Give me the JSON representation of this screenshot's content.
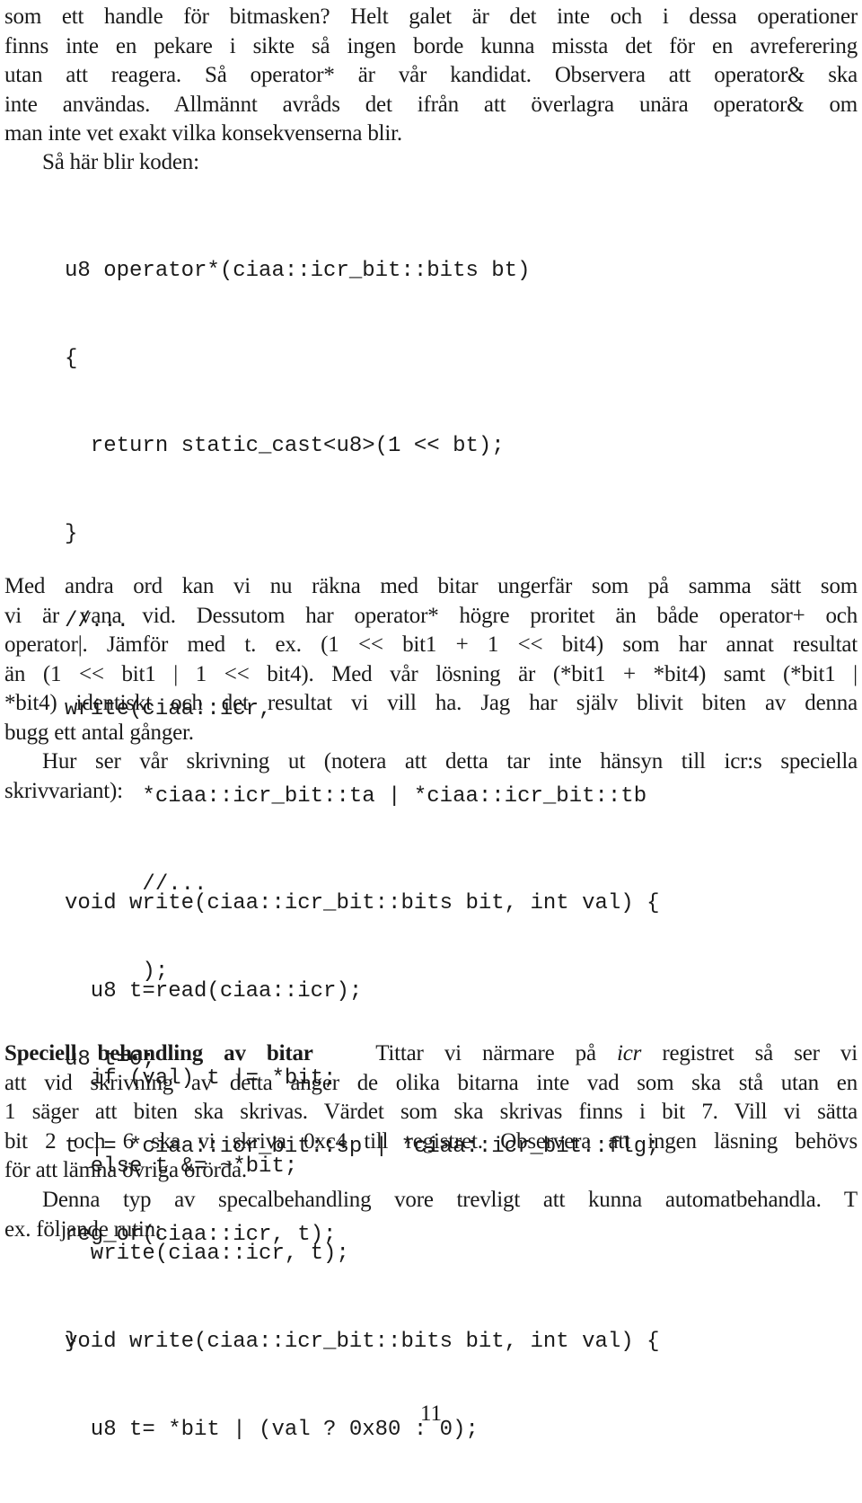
{
  "paragraph_1": {
    "lines": [
      "som ett handle för bitmasken?  Helt galet är det inte och i dessa operationer",
      "finns inte en pekare i sikte så ingen borde kunna missta det för en avreferering",
      "utan att reagera.  Så operator* är vår kandidat.  Observera att operator& ska",
      "inte användas.  Allmännt avråds det ifrån att överlagra unära operator& om",
      "man inte vet exakt vilka konsekvenserna blir."
    ]
  },
  "paragraph_2": {
    "lines": [
      "Så här blir koden:"
    ]
  },
  "code_block_1": {
    "lines": [
      "u8 operator*(ciaa::icr_bit::bits bt)",
      "{",
      "  return static_cast<u8>(1 << bt);",
      "}",
      "//...",
      "write(ciaa::icr,",
      "      *ciaa::icr_bit::ta | *ciaa::icr_bit::tb",
      "      //...",
      "      );",
      "u8 t=0;",
      "t |= *ciaa::icr_bit::sp | *ciaa::icr_bit::flg;",
      "reg_or(ciaa::icr, t);"
    ]
  },
  "paragraph_3": {
    "lines": [
      "Med andra ord kan vi nu räkna med bitar ungerfär som på samma sätt som",
      "vi är vana vid. Dessutom har operator* högre proritet än både operator+ och",
      "operator|. Jämför med t. ex. (1 << bit1 + 1 << bit4) som har annat resultat",
      "än (1 << bit1 | 1 << bit4). Med vår lösning är (*bit1 + *bit4) samt (*bit1 |",
      "*bit4) identiskt och det resultat vi vill ha.  Jag har själv blivit biten av denna",
      "bugg ett antal gånger."
    ]
  },
  "paragraph_4": {
    "lines": [
      "Hur ser vår skrivning ut (notera att detta tar inte hänsyn till icr:s speciella",
      "skrivvariant):"
    ]
  },
  "code_block_2": {
    "lines": [
      "void write(ciaa::icr_bit::bits bit, int val) {",
      "  u8 t=read(ciaa::icr);",
      "  if (val) t |= *bit;",
      "  else t &= ~*bit;",
      "  write(ciaa::icr, t);",
      "}"
    ]
  },
  "section": {
    "heading": "Speciell behandling av bitar",
    "first_line_pre": "Tittar vi närmare på ",
    "first_line_italic": "icr",
    "first_line_post": " registret så ser vi",
    "lines": [
      "att vid skrivning av detta anger de olika bitarna inte vad som ska stå utan en",
      "1 säger att biten ska skrivas. Värdet som ska skrivas finns i bit 7. Vill vi sätta",
      "bit 2 och 6 ska vi skriva 0xc4 till registret.  Observera att ingen läsning behövs",
      "för att lämna övriga orörda."
    ]
  },
  "paragraph_5": {
    "lines": [
      "Denna typ av specalbehandling vore trevligt att kunna automatbehandla. T",
      "ex. följande rutin:"
    ]
  },
  "code_block_3": {
    "lines": [
      "void write(ciaa::icr_bit::bits bit, int val) {",
      "  u8 t= *bit | (val ? 0x80 : 0);"
    ]
  },
  "page_number": "11"
}
